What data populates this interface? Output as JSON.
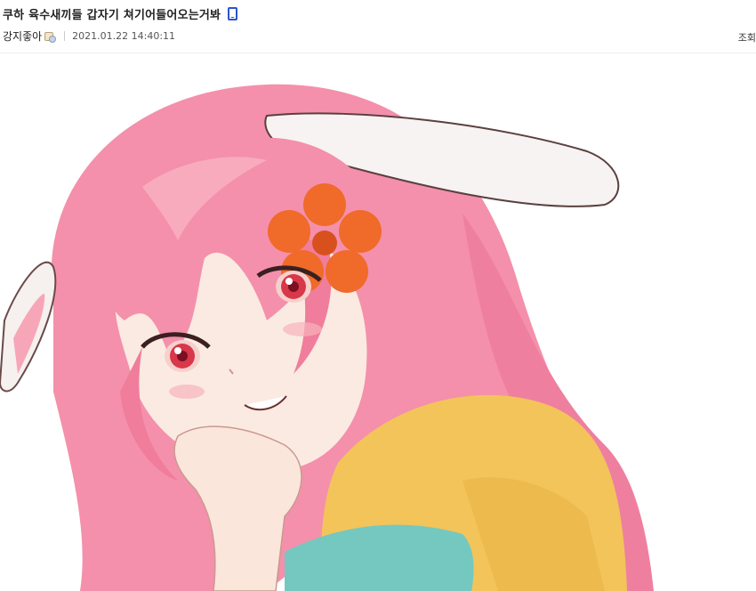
{
  "post": {
    "title": "쿠하 육수새끼들 갑자기 쳐기어들어오는거봐",
    "author": "강지좋아",
    "date": "2021.01.22 14:40:11",
    "views_label": "조회"
  },
  "icons": {
    "mobile": "mobile-phone-icon",
    "user": "user-level-icon"
  },
  "colors": {
    "mobile_icon": "#2c55cc",
    "hair": "#f08aa6",
    "shirt": "#f3c45a",
    "flower": "#f06a2a"
  }
}
